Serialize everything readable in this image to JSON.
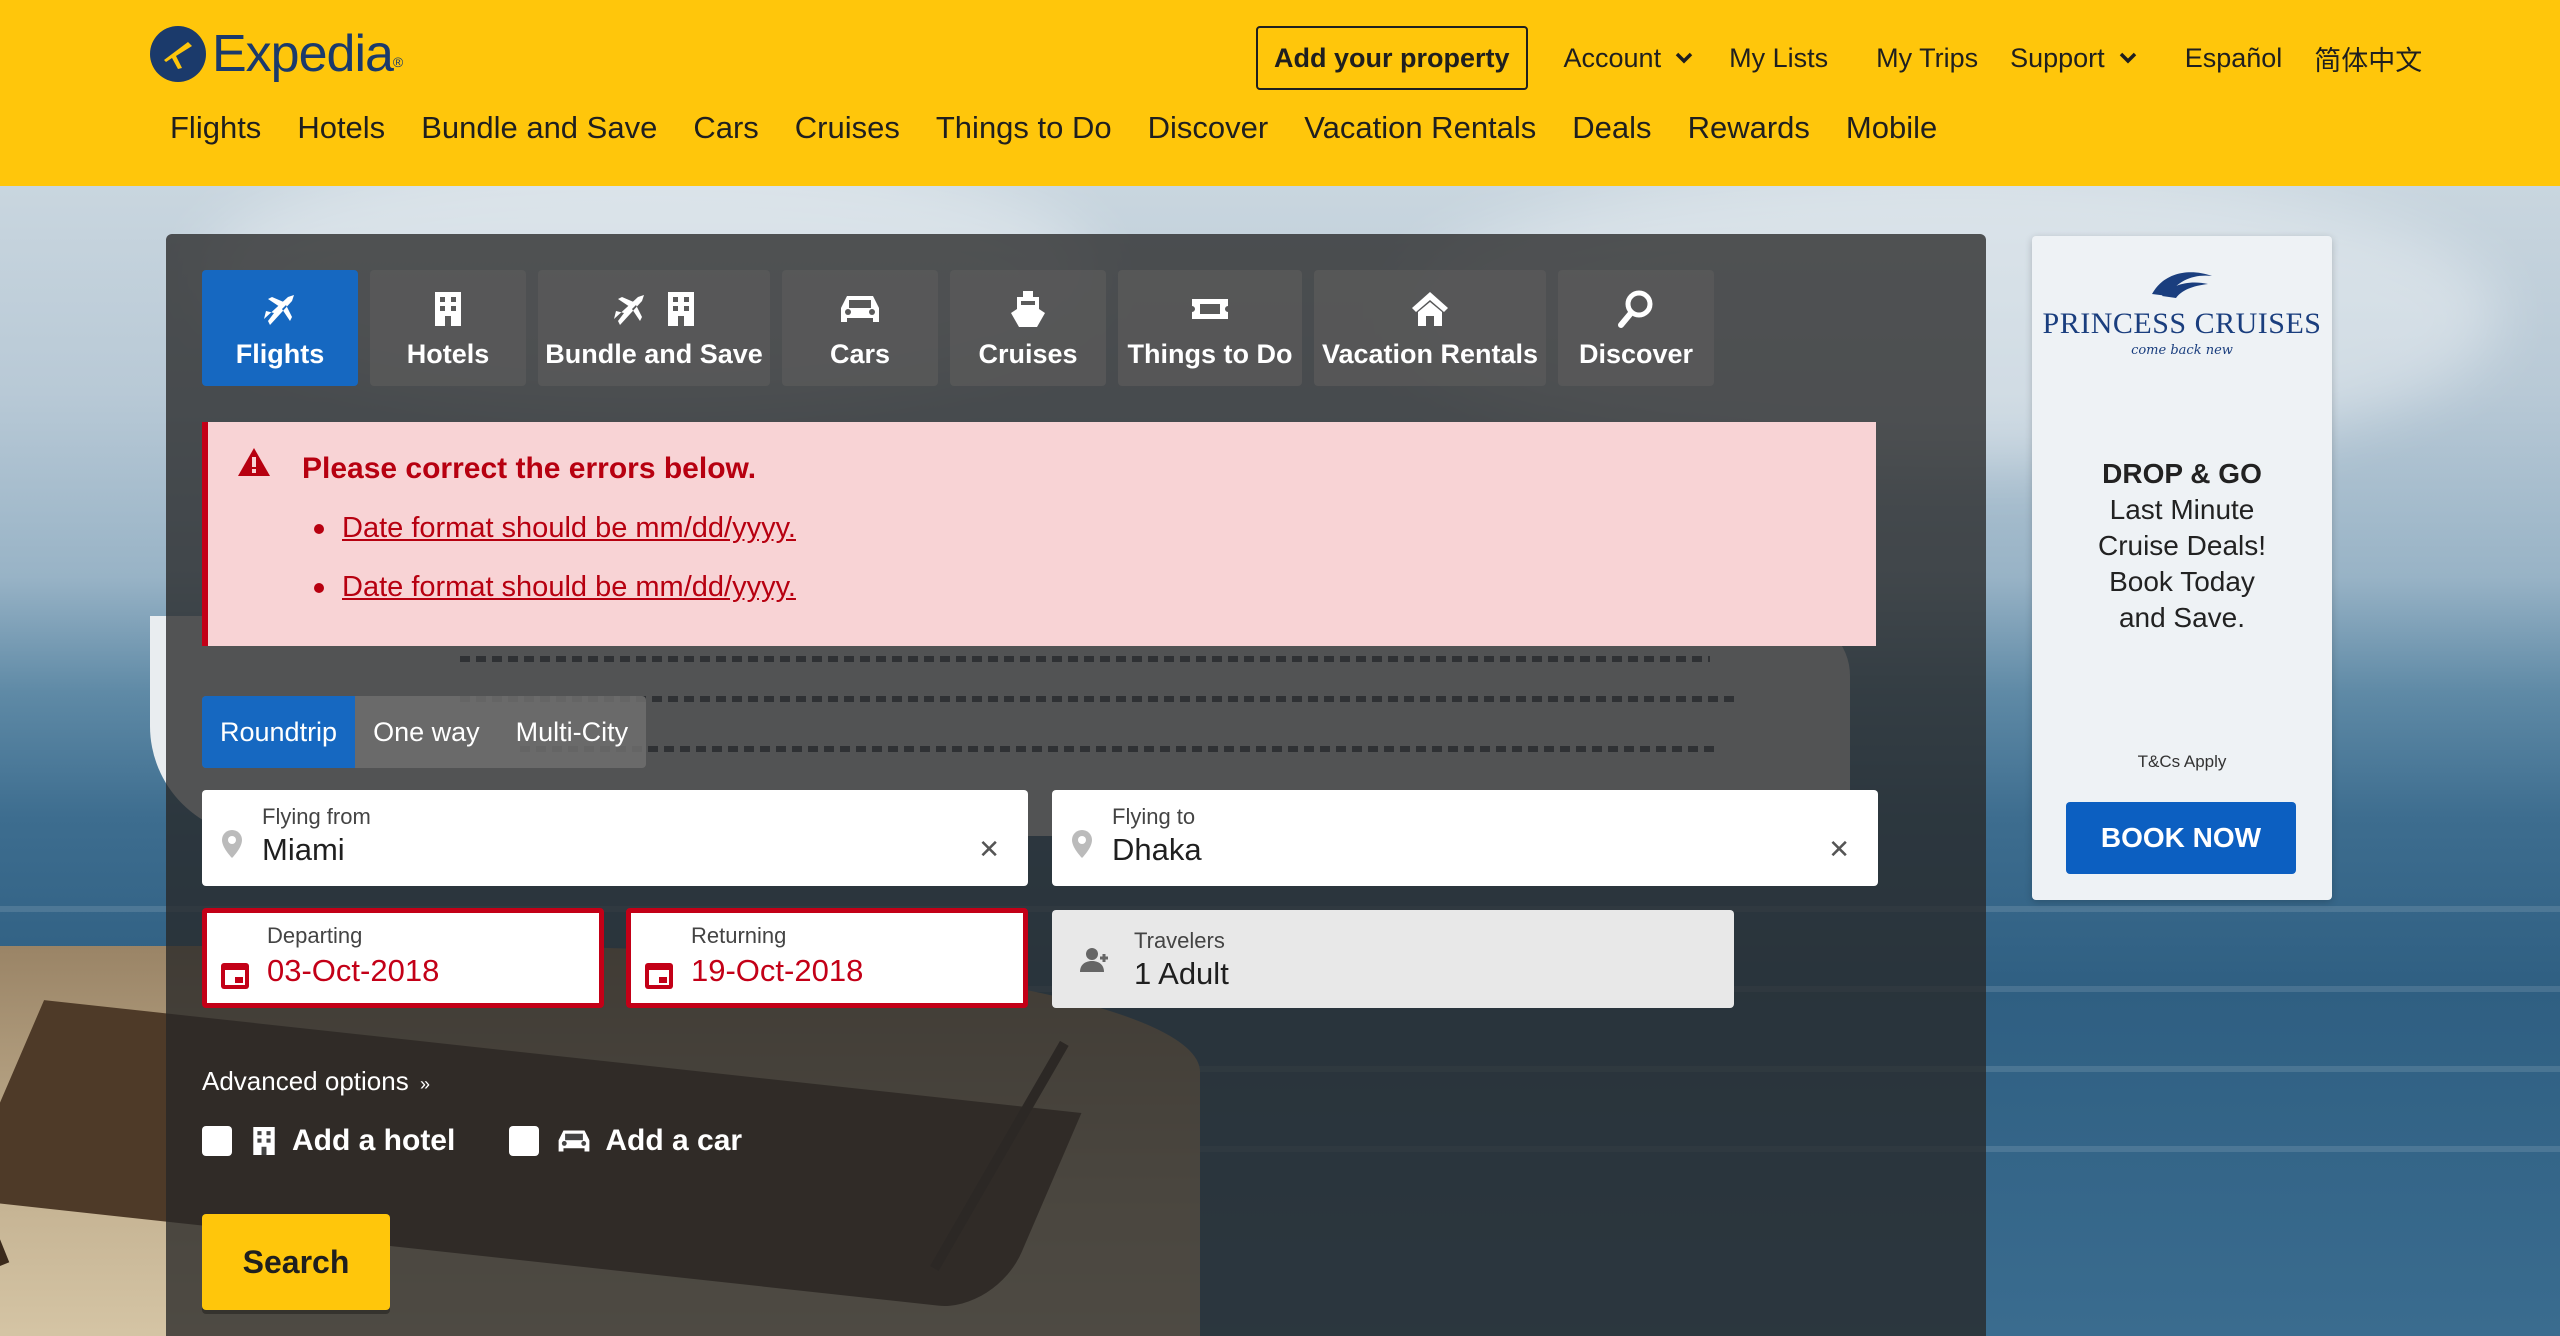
{
  "header": {
    "logo_text": "Expedia",
    "add_property": "Add your property",
    "top_links": {
      "account": "Account",
      "my_lists": "My Lists",
      "my_trips": "My Trips",
      "support": "Support",
      "espanol": "Español",
      "chinese": "简体中文"
    },
    "nav": [
      "Flights",
      "Hotels",
      "Bundle and Save",
      "Cars",
      "Cruises",
      "Things to Do",
      "Discover",
      "Vacation Rentals",
      "Deals",
      "Rewards",
      "Mobile"
    ]
  },
  "tabs": [
    {
      "label": "Flights",
      "icon": "plane-icon",
      "active": true
    },
    {
      "label": "Hotels",
      "icon": "building-icon",
      "active": false
    },
    {
      "label": "Bundle and Save",
      "icon": "plane-building-icon",
      "active": false
    },
    {
      "label": "Cars",
      "icon": "car-icon",
      "active": false
    },
    {
      "label": "Cruises",
      "icon": "ship-icon",
      "active": false
    },
    {
      "label": "Things to Do",
      "icon": "ticket-icon",
      "active": false
    },
    {
      "label": "Vacation Rentals",
      "icon": "house-icon",
      "active": false
    },
    {
      "label": "Discover",
      "icon": "magnifier-icon",
      "active": false
    }
  ],
  "errors": {
    "title": "Please correct the errors below.",
    "items": [
      "Date format should be mm/dd/yyyy.",
      "Date format should be mm/dd/yyyy."
    ]
  },
  "trip_type": {
    "roundtrip": "Roundtrip",
    "one_way": "One way",
    "multi_city": "Multi-City",
    "selected": "Roundtrip"
  },
  "fields": {
    "from_label": "Flying from",
    "from_value": "Miami",
    "to_label": "Flying to",
    "to_value": "Dhaka",
    "departing_label": "Departing",
    "departing_value": "03-Oct-2018",
    "returning_label": "Returning",
    "returning_value": "19-Oct-2018",
    "travelers_label": "Travelers",
    "travelers_value": "1 Adult"
  },
  "advanced_options": "Advanced options",
  "addons": {
    "hotel": "Add a hotel",
    "car": "Add a car"
  },
  "search_button": "Search",
  "ad": {
    "brand": "PRINCESS CRUISES",
    "tagline": "come back new",
    "headline": "DROP & GO",
    "lines": [
      "Last Minute",
      "Cruise Deals!",
      "Book Today",
      "and Save."
    ],
    "tc": "T&Cs Apply",
    "cta": "BOOK NOW"
  },
  "colors": {
    "header_yellow": "#ffc60b",
    "active_blue": "#1668c1",
    "error_red": "#c30017",
    "error_bg": "#f8d3d5"
  }
}
